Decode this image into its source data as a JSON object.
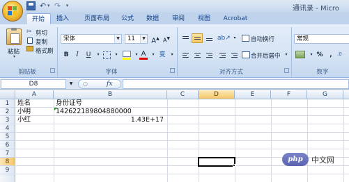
{
  "window": {
    "title": "通讯录 - Micro"
  },
  "quick_access": {
    "save_icon": "save-icon",
    "undo_icon": "undo-icon",
    "redo_icon": "redo-icon",
    "more_glyph": "▾"
  },
  "tabs": [
    {
      "label": "开始"
    },
    {
      "label": "插入"
    },
    {
      "label": "页面布局"
    },
    {
      "label": "公式"
    },
    {
      "label": "数据"
    },
    {
      "label": "审阅"
    },
    {
      "label": "视图"
    },
    {
      "label": "Acrobat"
    }
  ],
  "ribbon": {
    "clipboard": {
      "label": "剪贴板",
      "paste": "粘贴",
      "cut": "剪切",
      "copy": "复制",
      "format_painter": "格式刷"
    },
    "font": {
      "label": "字体",
      "font_name": "宋体",
      "font_size": "11",
      "bold": "B",
      "italic": "I",
      "underline": "U",
      "grow": "A",
      "shrink": "A",
      "wen": "变"
    },
    "alignment": {
      "label": "对齐方式",
      "wrap_text": "自动换行",
      "merge_center": "合并后居中"
    },
    "number": {
      "label": "数字",
      "format": "常规",
      "percent": "%",
      "comma": ","
    }
  },
  "formula_bar": {
    "name_box": "D8",
    "fx": "fx",
    "content": ""
  },
  "grid": {
    "columns": [
      "A",
      "B",
      "C",
      "D",
      "E",
      "F",
      "G"
    ],
    "rows": [
      "1",
      "2",
      "3",
      "4",
      "5",
      "6",
      "7",
      "8",
      "9"
    ],
    "active_column": "D",
    "active_row": "8",
    "cells": {
      "A1": "姓名",
      "B1": "身份证号",
      "A2": "小明",
      "B2": "142622189804880000",
      "A3": "小红",
      "B3": "1.43E+17"
    }
  },
  "watermark": {
    "badge": "php",
    "text": "中文网"
  }
}
